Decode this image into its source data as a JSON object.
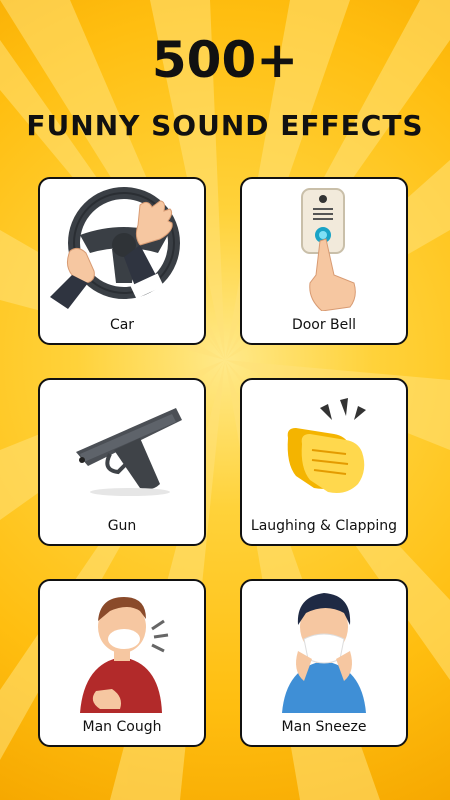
{
  "header": {
    "title": "500+",
    "subtitle": "FUNNY SOUND EFFECTS"
  },
  "cards": [
    {
      "label": "Car",
      "icon": "steering-wheel-icon"
    },
    {
      "label": "Door Bell",
      "icon": "doorbell-icon"
    },
    {
      "label": "Gun",
      "icon": "pistol-icon"
    },
    {
      "label": "Laughing & Clapping",
      "icon": "clapping-hands-icon"
    },
    {
      "label": "Man Cough",
      "icon": "coughing-man-icon"
    },
    {
      "label": "Man Sneeze",
      "icon": "sneezing-man-icon"
    }
  ],
  "colors": {
    "background": "#FFC21A",
    "card": "#FFFFFF",
    "text": "#111111"
  }
}
